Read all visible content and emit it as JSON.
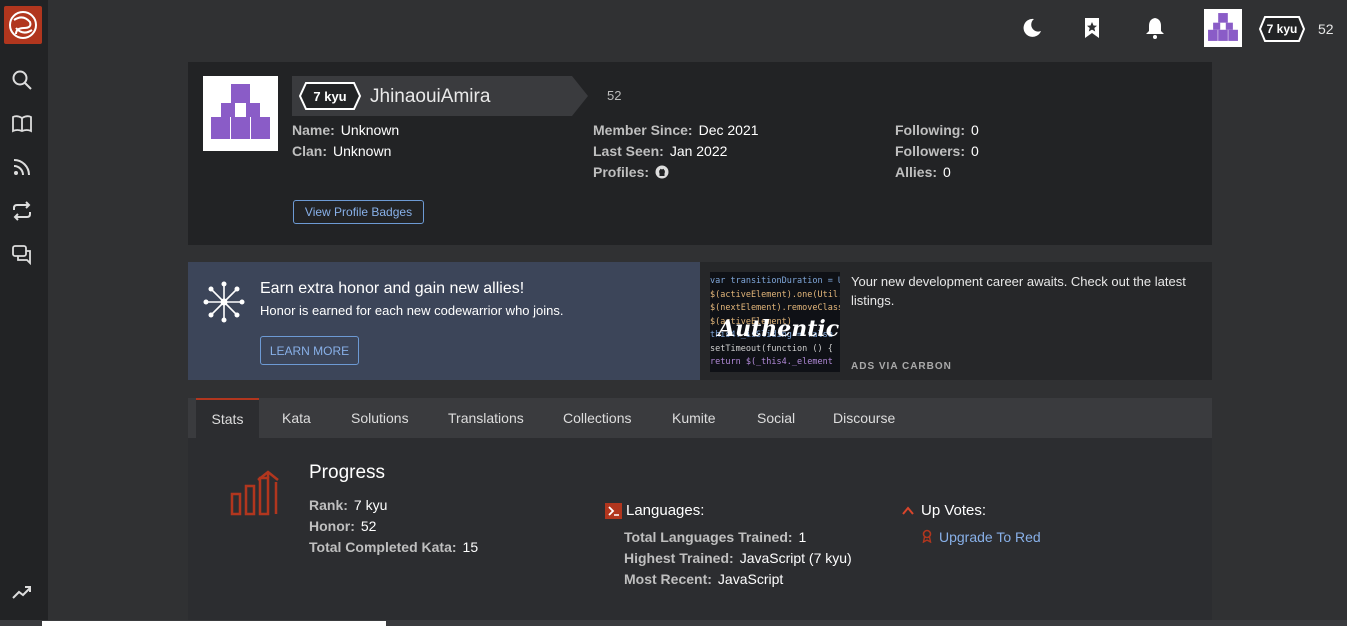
{
  "sidebar": {
    "icons": [
      "logo-icon",
      "search-icon",
      "book-icon",
      "rss-icon",
      "repeat-icon",
      "chat-icon",
      "trending-icon"
    ]
  },
  "topbar": {
    "icons": [
      "moon-icon",
      "bookmark-icon",
      "bell-icon"
    ],
    "rank": "7 kyu",
    "honor": "52"
  },
  "profile": {
    "rank": "7 kyu",
    "username": "JhinaouiAmira",
    "honor": "52",
    "col1": [
      {
        "label": "Name:",
        "value": "Unknown"
      },
      {
        "label": "Clan:",
        "value": "Unknown"
      }
    ],
    "col2": [
      {
        "label": "Member Since:",
        "value": "Dec 2021"
      },
      {
        "label": "Last Seen:",
        "value": "Jan 2022"
      },
      {
        "label": "Profiles:",
        "value": ""
      }
    ],
    "col3": [
      {
        "label": "Following:",
        "value": "0"
      },
      {
        "label": "Followers:",
        "value": "0"
      },
      {
        "label": "Allies:",
        "value": "0"
      }
    ],
    "badges_button": "View Profile Badges"
  },
  "promo": {
    "title": "Earn extra honor and gain new allies!",
    "subtitle": "Honor is earned for each new codewarrior who joins.",
    "button": "LEARN MORE"
  },
  "ad": {
    "text": "Your new development career awaits. Check out the latest listings.",
    "via": "ADS VIA CARBON",
    "image_word": "Authentic",
    "code_lines": [
      "var transitionDuration = Util",
      "$(activeElement).one(Util.Tr",
      "$(nextElement).removeClass",
      "$(activeElement)",
      "  this4._isSliding = false",
      "setTimeout(function () {",
      "  return $(_this4._element"
    ]
  },
  "tabs": [
    "Stats",
    "Kata",
    "Solutions",
    "Translations",
    "Collections",
    "Kumite",
    "Social",
    "Discourse"
  ],
  "active_tab": "Stats",
  "stats": {
    "progress_title": "Progress",
    "progress": [
      {
        "label": "Rank:",
        "value": "7 kyu"
      },
      {
        "label": "Honor:",
        "value": "52"
      },
      {
        "label": "Total Completed Kata:",
        "value": "15"
      }
    ],
    "languages_title": "Languages:",
    "languages": [
      {
        "label": "Total Languages Trained:",
        "value": "1"
      },
      {
        "label": "Highest Trained:",
        "value": "JavaScript (7 kyu)"
      },
      {
        "label": "Most Recent:",
        "value": "JavaScript"
      }
    ],
    "upvotes_title": "Up Votes:",
    "upgrade_link": "Upgrade To Red"
  },
  "colors": {
    "accent": "#b1361e",
    "avatar_purple": "#8a5cc7",
    "link": "#88b0e8"
  }
}
